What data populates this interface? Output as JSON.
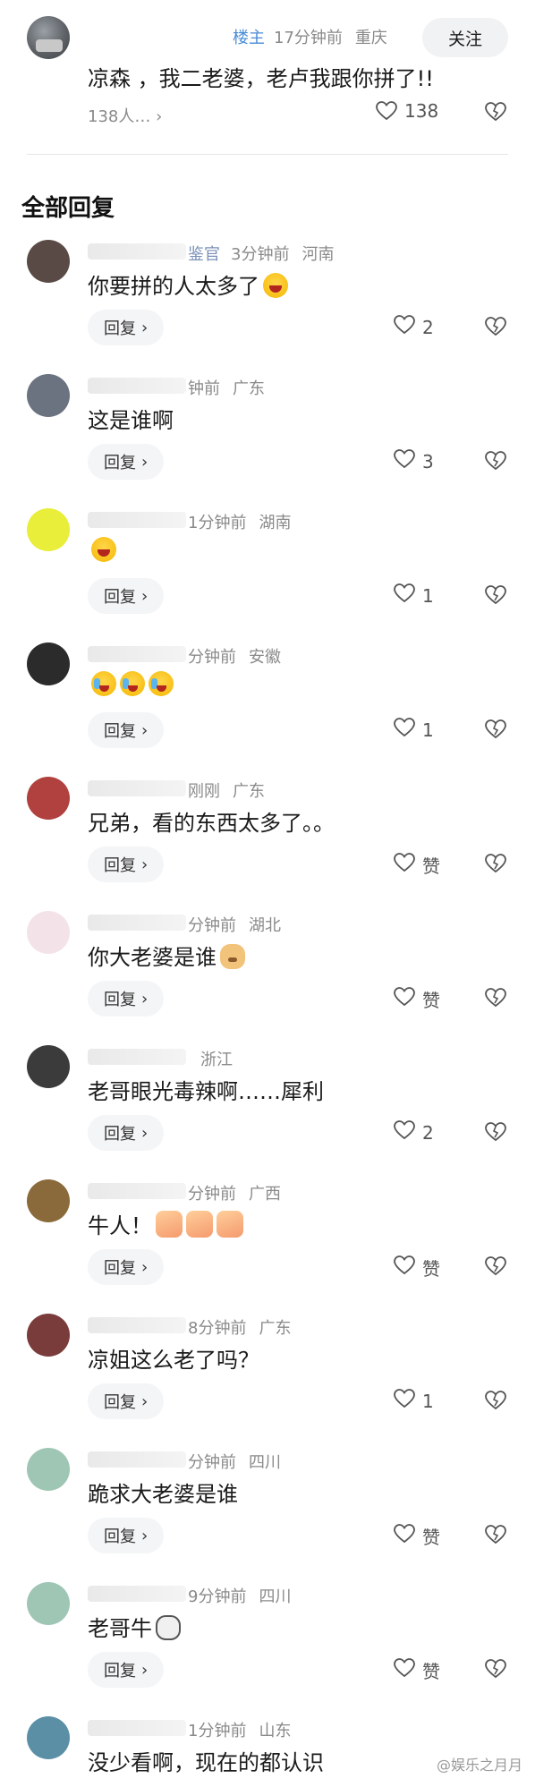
{
  "top_comment": {
    "tag": "楼主",
    "time": "17分钟前",
    "location": "重庆",
    "follow_label": "关注",
    "content": "凉森    ，我二老婆，老卢我跟你拼了!!",
    "replies_text": "138人…",
    "like_count": "138"
  },
  "section_title": "全部回复",
  "reply_label": "回复",
  "comments": [
    {
      "badge": "鉴官",
      "time": "3分钟前",
      "location": "河南",
      "text": "你要拼的人太多了",
      "emoji": "laugh",
      "likes": "2",
      "avatar_color": "#5a4a45"
    },
    {
      "badge": "",
      "time": "钟前",
      "location": "广东",
      "text": "这是谁啊",
      "emoji": "",
      "likes": "3",
      "avatar_color": "#6b7280"
    },
    {
      "badge": "",
      "time": "1分钟前",
      "location": "湖南",
      "text": "",
      "emoji": "laugh",
      "likes": "1",
      "avatar_color": "#e9ee3a"
    },
    {
      "badge": "",
      "time": "分钟前",
      "location": "安徽",
      "text": "",
      "emoji": "cry3",
      "likes": "1",
      "avatar_color": "#2b2b2b"
    },
    {
      "badge": "",
      "time": "刚刚",
      "location": "广东",
      "text": "兄弟，看的东西太多了。。",
      "emoji": "",
      "likes": "赞",
      "avatar_color": "#b0413e"
    },
    {
      "badge": "",
      "time": "分钟前",
      "location": "湖北",
      "text": "你大老婆是谁",
      "emoji": "dog",
      "likes": "赞",
      "avatar_color": "#f3e3e8"
    },
    {
      "badge": "",
      "time": "",
      "location": "浙江",
      "text": "老哥眼光毒辣啊……犀利",
      "emoji": "",
      "likes": "2",
      "avatar_color": "#3b3b3b"
    },
    {
      "badge": "",
      "time": "分钟前",
      "location": "广西",
      "text": "牛人！",
      "emoji": "thumb3",
      "likes": "赞",
      "avatar_color": "#8a6a3a"
    },
    {
      "badge": "",
      "time": "8分钟前",
      "location": "广东",
      "text": "凉姐这么老了吗？",
      "emoji": "",
      "likes": "1",
      "avatar_color": "#7a3b3b"
    },
    {
      "badge": "",
      "time": "分钟前",
      "location": "四川",
      "text": "跪求大老婆是谁",
      "emoji": "",
      "likes": "赞",
      "avatar_color": "#9fc6b4"
    },
    {
      "badge": "",
      "time": "9分钟前",
      "location": "四川",
      "text": "老哥牛",
      "emoji": "cow",
      "likes": "赞",
      "avatar_color": "#9fc6b4"
    },
    {
      "badge": "",
      "time": "1分钟前",
      "location": "山东",
      "text": "没少看啊，现在的都认识",
      "emoji": "",
      "likes": "",
      "avatar_color": "#5b8fa6"
    }
  ],
  "watermark": "@娱乐之月月"
}
